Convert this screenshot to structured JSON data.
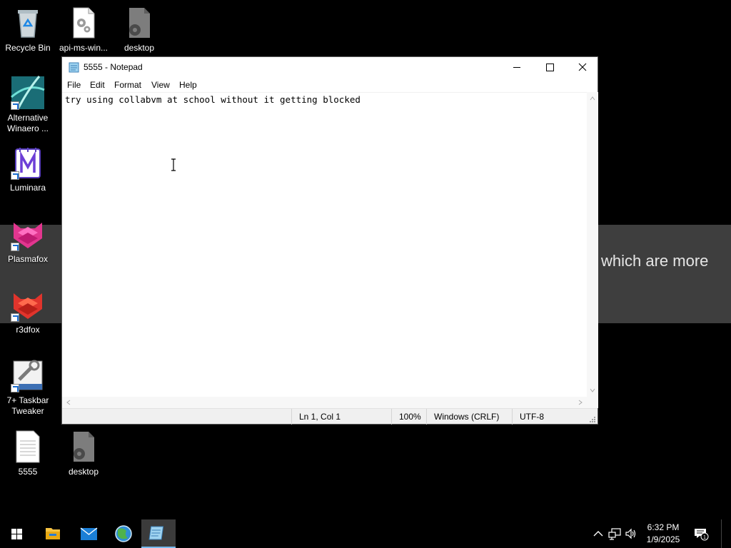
{
  "wallpaper": {
    "visible_text": "which are more"
  },
  "desktop_icons": [
    {
      "label": "Recycle Bin"
    },
    {
      "label": "api-ms-win..."
    },
    {
      "label": "desktop"
    },
    {
      "label": "Alternative Winaero ..."
    },
    {
      "label": "Luminara"
    },
    {
      "label": "Plasmafox"
    },
    {
      "label": "r3dfox"
    },
    {
      "label": "7+ Taskbar Tweaker"
    },
    {
      "label": "5555"
    },
    {
      "label": "desktop"
    }
  ],
  "notepad": {
    "title": "5555 - Notepad",
    "menu": [
      "File",
      "Edit",
      "Format",
      "View",
      "Help"
    ],
    "content": "try using collabvm at school without it getting blocked",
    "status": {
      "position": "Ln 1, Col 1",
      "zoom": "100%",
      "line_ending": "Windows (CRLF)",
      "encoding": "UTF-8"
    }
  },
  "taskbar": {
    "pinned": [
      "start-icon",
      "file-explorer-icon",
      "mail-icon",
      "browser-icon",
      "notepad-icon"
    ],
    "clock": {
      "time": "6:32 PM",
      "date": "1/9/2025"
    },
    "notification_count": "1"
  },
  "colors": {
    "desktop": "#000000",
    "taskbar": "#000000",
    "accent": "#76b9ed",
    "window": "#ffffff",
    "statusbar": "#f0f0f0"
  }
}
